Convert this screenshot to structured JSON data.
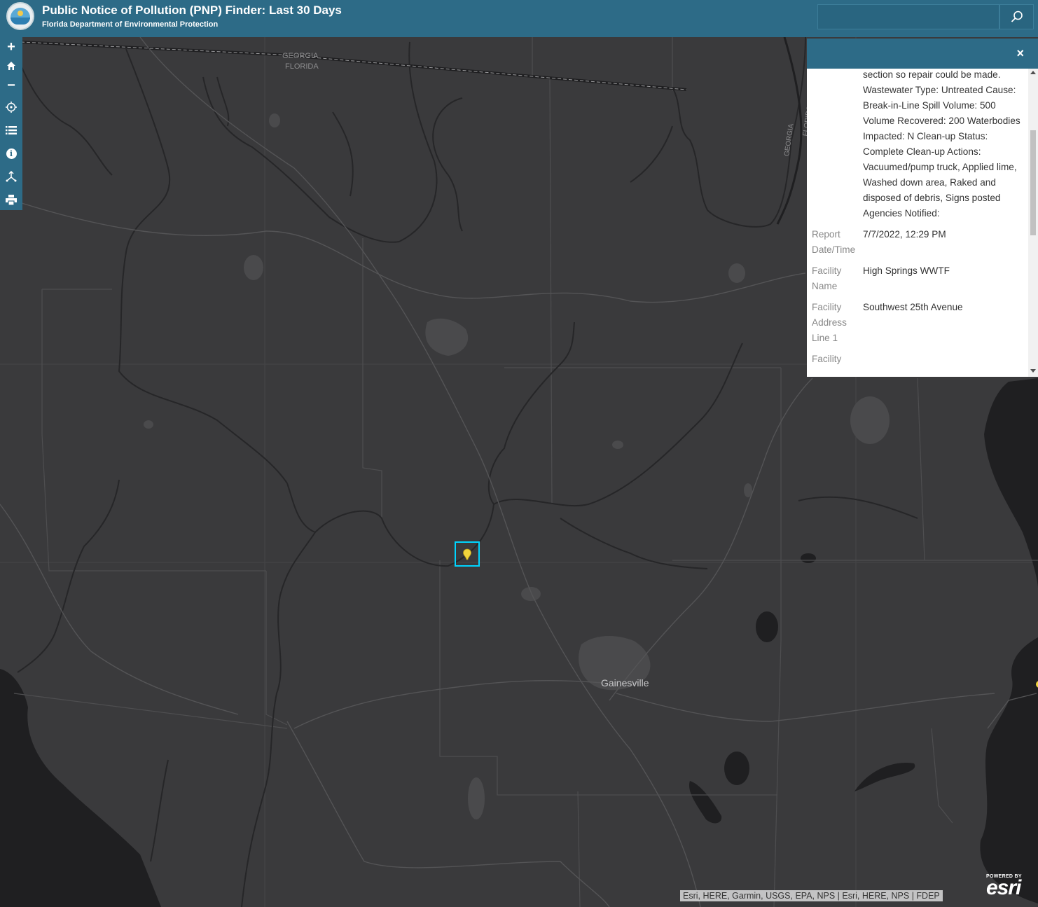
{
  "app": {
    "title": "Public Notice of Pollution (PNP) Finder: Last 30 Days",
    "subtitle": "Florida Department of Environmental Protection",
    "search": {
      "placeholder": "",
      "icon": "search-icon"
    }
  },
  "toolbar": {
    "items": [
      {
        "name": "zoom-in",
        "icon": "plus-icon",
        "glyph": "+"
      },
      {
        "name": "home",
        "icon": "home-icon"
      },
      {
        "name": "zoom-out",
        "icon": "minus-icon",
        "glyph": "−"
      },
      {
        "name": "locate",
        "icon": "locate-icon"
      },
      {
        "name": "layer-list",
        "icon": "list-icon"
      },
      {
        "name": "about",
        "icon": "info-icon",
        "glyph": "i"
      },
      {
        "name": "measure",
        "icon": "measure-icon"
      },
      {
        "name": "print",
        "icon": "print-icon"
      }
    ]
  },
  "popup": {
    "close_glyph": "×",
    "description": "section so repair could be made. Wastewater Type: Untreated Cause: Break-in-Line Spill Volume: 500 Volume Recovered: 200 Waterbodies Impacted: N Clean-up Status: Complete Clean-up Actions: Vacuumed/pump truck, Applied lime, Washed down area, Raked and disposed of debris, Signs posted Agencies Notified:",
    "fields": [
      {
        "label": "Report Date/Time",
        "value": "7/7/2022, 12:29 PM"
      },
      {
        "label": "Facility Name",
        "value": "High Springs WWTF"
      },
      {
        "label": "Facility Address Line 1",
        "value": "Southwest 25th Avenue"
      },
      {
        "label": "Facility",
        "value": ""
      }
    ]
  },
  "map": {
    "labels": {
      "state_border_1": "GEORGIA",
      "state_border_2": "FLORIDA",
      "state_border_vertical_1": "GEORGIA",
      "state_border_vertical_2": "FLORIDA",
      "city": "Gainesville"
    },
    "attribution": "Esri, HERE, Garmin, USGS, EPA, NPS | Esri, HERE, NPS | FDEP",
    "esri_powered": "POWERED BY",
    "esri_brand": "esri",
    "colors": {
      "land": "#3a3a3c",
      "water": "#1f1f21",
      "header": "#2d6b87",
      "marker": "#f2d53c",
      "selection": "#00d5ff"
    }
  }
}
